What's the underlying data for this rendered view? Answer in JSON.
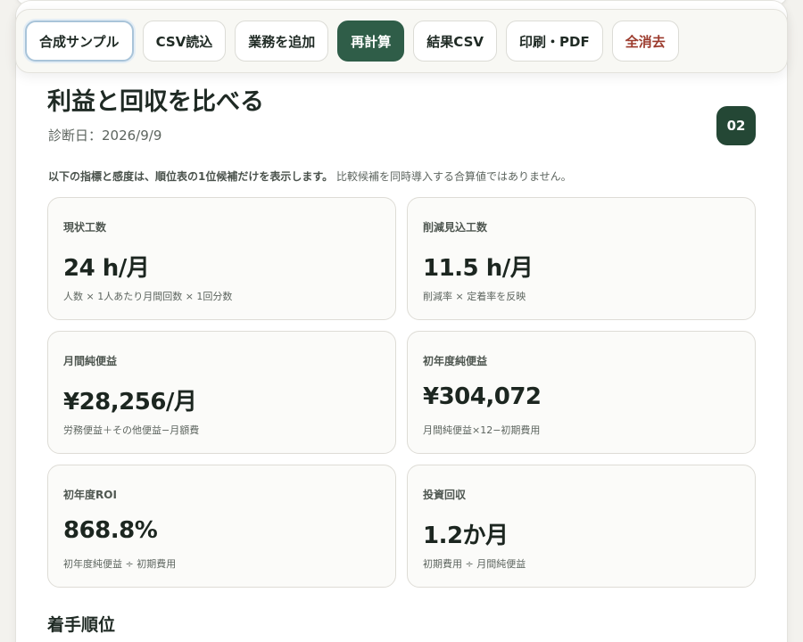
{
  "toolbar": {
    "buttons": [
      {
        "label": "合成サンプル",
        "style": "selected"
      },
      {
        "label": "CSV読込",
        "style": "default"
      },
      {
        "label": "業務を追加",
        "style": "default"
      },
      {
        "label": "再計算",
        "style": "primary"
      },
      {
        "label": "結果CSV",
        "style": "default"
      },
      {
        "label": "印刷・PDF",
        "style": "default"
      },
      {
        "label": "全消去",
        "style": "danger"
      }
    ]
  },
  "section": {
    "title": "利益と回収を比べる",
    "diagnosis_date": "診断日：2026/9/9",
    "step_number": "02",
    "notice_strong": "以下の指標と感度は、順位表の1位候補だけを表示します。",
    "notice_rest": "比較候補を同時導入する合算値ではありません。"
  },
  "metrics": [
    {
      "label": "現状工数",
      "value": "24 h/月",
      "note": "人数 × 1人あたり月間回数 × 1回分数"
    },
    {
      "label": "削減見込工数",
      "value": "11.5 h/月",
      "note": "削減率 × 定着率を反映"
    },
    {
      "label": "月間純便益",
      "value": "¥28,256/月",
      "note": "労務便益＋その他便益−月額費"
    },
    {
      "label": "初年度純便益",
      "value": "¥304,072",
      "note": "月間純便益×12−初期費用"
    },
    {
      "label": "初年度ROI",
      "value": "868.8%",
      "note": "初年度純便益 ÷ 初期費用"
    },
    {
      "label": "投資回収",
      "value": "1.2か月",
      "note": "初期費用 ÷ 月間純便益"
    }
  ],
  "next_section": {
    "title": "着手順位"
  },
  "colors": {
    "primary": "#2f5d48",
    "badge": "#244735",
    "danger": "#9b3a2c"
  }
}
